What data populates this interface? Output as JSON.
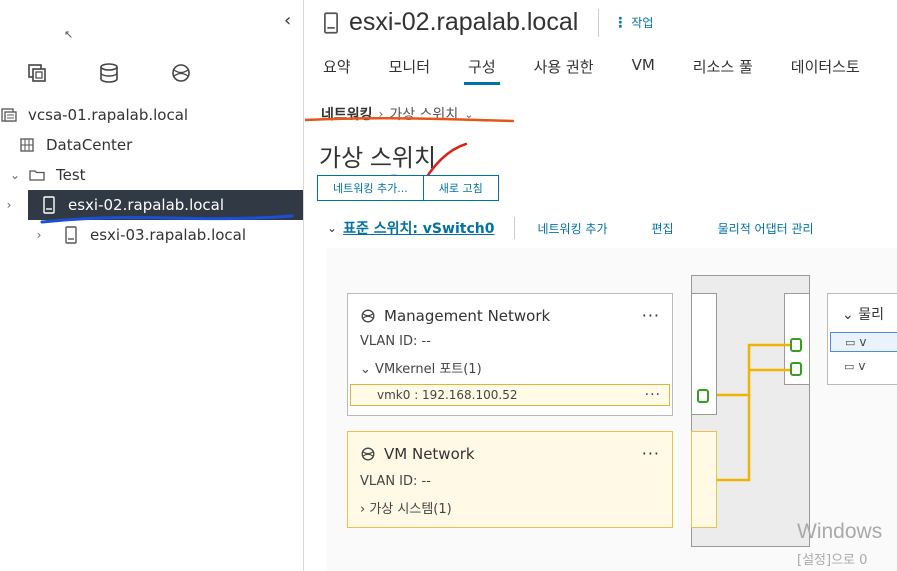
{
  "sidebar": {
    "tree": [
      {
        "label": "vcsa-01.rapalab.local",
        "icon": "vcenter-icon"
      },
      {
        "label": "DataCenter",
        "icon": "datacenter-icon"
      },
      {
        "label": "Test",
        "icon": "folder-icon"
      },
      {
        "label": "esxi-02.rapalab.local",
        "icon": "host-icon",
        "selected": true
      },
      {
        "label": "esxi-03.rapalab.local",
        "icon": "host-icon"
      }
    ]
  },
  "header": {
    "title": "esxi-02.rapalab.local",
    "actions_label": "작업"
  },
  "tabs": [
    "요약",
    "모니터",
    "구성",
    "사용 권한",
    "VM",
    "리소스 풀",
    "데이터스토"
  ],
  "breadcrumb": {
    "root": "네트워킹",
    "current": "가상 스위치"
  },
  "page_title": "가상 스위치",
  "buttons": {
    "add_network": "네트워킹 추가...",
    "refresh": "새로 고침"
  },
  "vswitch": {
    "title": "표준 스위치: vSwitch0",
    "actions": [
      "네트워킹 추가",
      "편집",
      "물리적 어댑터 관리"
    ]
  },
  "port_groups": [
    {
      "name": "Management Network",
      "vlan": "VLAN ID: --",
      "ports_label": "VMkernel 포트(1)",
      "vmk": "vmk0 : 192.168.100.52"
    },
    {
      "name": "VM Network",
      "vlan": "VLAN ID: --",
      "vms_label": "가상 시스템(1)"
    }
  ],
  "physical": {
    "title": "물리",
    "items": [
      "v",
      "v"
    ]
  },
  "watermark": {
    "line1": "Windows",
    "line2": "[설정]으로 0"
  },
  "colors": {
    "accent": "#0072a3",
    "selected_row": "#313a44",
    "vm_group_bg": "#fff9e6",
    "link_line": "#f0b400",
    "port_green": "#3a9d23",
    "annotation_blue": "#1a4fd6",
    "annotation_orange": "#e8551a",
    "annotation_red": "#d9251d"
  }
}
